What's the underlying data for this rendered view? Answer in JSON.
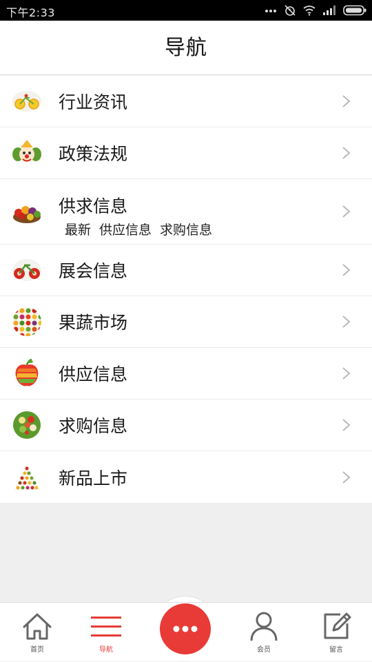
{
  "status_bar": {
    "time": "下午2:33",
    "icons": [
      "more-dots-icon",
      "alarm-off-icon",
      "wifi-icon",
      "signal-icon",
      "battery-icon"
    ]
  },
  "header": {
    "title": "导航"
  },
  "nav_items": [
    {
      "label": "行业资讯",
      "icon": "fruit-bicycle-thumbnail"
    },
    {
      "label": "政策法规",
      "icon": "vegetable-clown-thumbnail"
    },
    {
      "label": "供求信息",
      "icon": "fruit-basket-thumbnail",
      "sublinks": [
        "最新",
        "供应信息",
        "求购信息"
      ]
    },
    {
      "label": "展会信息",
      "icon": "vegetable-bike-thumbnail"
    },
    {
      "label": "果蔬市场",
      "icon": "fruit-grid-thumbnail"
    },
    {
      "label": "供应信息",
      "icon": "fruit-apple-mosaic-thumbnail"
    },
    {
      "label": "求购信息",
      "icon": "salad-bowl-thumbnail"
    },
    {
      "label": "新品上市",
      "icon": "food-pyramid-thumbnail"
    }
  ],
  "tab_bar": {
    "tabs": [
      {
        "label": "首页",
        "icon": "home-icon"
      },
      {
        "label": "导航",
        "icon": "menu-icon",
        "active": true
      },
      {
        "label": "",
        "icon": "more-icon"
      },
      {
        "label": "会员",
        "icon": "user-icon"
      },
      {
        "label": "留言",
        "icon": "edit-note-icon"
      }
    ]
  },
  "colors": {
    "accent": "#e83a36",
    "status_bar": "#000000",
    "page_background": "#efefef",
    "list_background": "#ffffff"
  }
}
